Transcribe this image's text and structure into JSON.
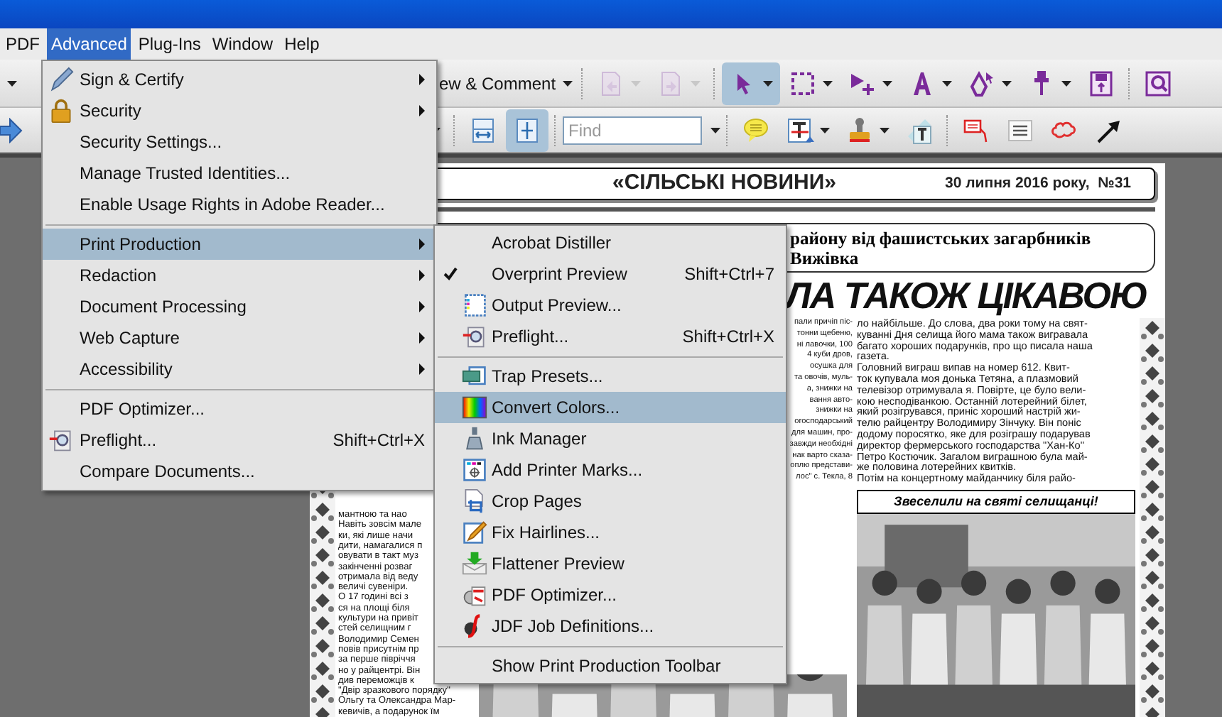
{
  "menubar": [
    {
      "label": "PDF",
      "selected": false
    },
    {
      "label": "Advanced",
      "selected": true
    },
    {
      "label": "Plug-Ins",
      "selected": false
    },
    {
      "label": "Window",
      "selected": false
    },
    {
      "label": "Help",
      "selected": false
    }
  ],
  "toolbar_1": [
    {
      "kind": "text",
      "label": "ew & Comment",
      "dropdown": true,
      "selected": false,
      "disabled": false
    },
    {
      "kind": "separator"
    },
    {
      "kind": "icon",
      "dropdown": true,
      "selected": false,
      "disabled": true
    },
    {
      "kind": "icon",
      "dropdown": true,
      "selected": false,
      "disabled": true
    },
    {
      "kind": "separator"
    },
    {
      "kind": "icon",
      "dropdown": true,
      "selected": true,
      "disabled": false
    },
    {
      "kind": "icon",
      "dropdown": true,
      "selected": false,
      "disabled": false
    },
    {
      "kind": "icon",
      "dropdown": true,
      "selected": false,
      "disabled": false
    },
    {
      "kind": "icon",
      "dropdown": true,
      "selected": false,
      "disabled": false
    },
    {
      "kind": "icon",
      "dropdown": true,
      "selected": false,
      "disabled": false
    },
    {
      "kind": "icon",
      "dropdown": true,
      "selected": false,
      "disabled": false
    },
    {
      "kind": "icon",
      "dropdown": false,
      "selected": false,
      "disabled": false
    },
    {
      "kind": "separator"
    },
    {
      "kind": "icon",
      "dropdown": false,
      "selected": false,
      "disabled": false
    }
  ],
  "toolbar_2": [
    {
      "kind": "separator"
    },
    {
      "kind": "icon",
      "dropdown": false,
      "selected": false,
      "disabled": false
    },
    {
      "kind": "icon",
      "dropdown": false,
      "selected": true,
      "disabled": false
    },
    {
      "kind": "separator"
    },
    {
      "kind": "field",
      "placeholder": "Find",
      "dropdown": true
    },
    {
      "kind": "separator"
    },
    {
      "kind": "icon",
      "dropdown": false,
      "selected": false,
      "disabled": false
    },
    {
      "kind": "icon",
      "dropdown": true,
      "selected": false,
      "disabled": false
    },
    {
      "kind": "icon",
      "dropdown": true,
      "selected": false,
      "disabled": false
    },
    {
      "kind": "icon",
      "dropdown": false,
      "selected": false,
      "disabled": false
    },
    {
      "kind": "separator"
    },
    {
      "kind": "icon",
      "dropdown": false,
      "selected": false,
      "disabled": false
    },
    {
      "kind": "icon",
      "dropdown": false,
      "selected": false,
      "disabled": false
    },
    {
      "kind": "icon",
      "dropdown": false,
      "selected": false,
      "disabled": false
    },
    {
      "kind": "icon",
      "dropdown": false,
      "selected": false,
      "disabled": false
    }
  ],
  "newspaper": {
    "title": "«СІЛЬСЬКІ НОВИНИ»",
    "date": "30 липня 2016 року,  №31",
    "subheadline": [
      "району від фашистських загарбників",
      "Вижівка"
    ],
    "headline": "ЛА ТАКОЖ ЦІКАВОЮ",
    "column_1": [
      "мантною та нао",
      "Навіть зовсім мале",
      "ки, які лише начи",
      "дити, намагалися п",
      "овувати в такт муз",
      "закінченні розваг",
      "отримала від веду",
      "величі сувеніри.",
      "О 17 годині всі з",
      "ся  на площі біля",
      "культури на привіт",
      "стей селищним г",
      "Володимир Семен",
      "повів присутнім пр",
      "за перше півріччя",
      "но у райцентрі. Він",
      "див переможців к",
      "\"Двір зразкового порядку\"",
      "Ольгу та Олександра Мар-",
      "кевичів, а подарунок їм"
    ],
    "column_2": [
      "пали причіп піс-",
      "тонни щебеню,",
      "ні лавочки, 100",
      "4 куби дров,",
      "осушка    для",
      "та овочів, муль-",
      "а, знижки на",
      "вання    авто-",
      "знижки на",
      "огосподарський",
      "для машин, про-",
      "завжди необхідні",
      "нак варто сказа-",
      "оплю представи-",
      "лос\" с. Текла, 8"
    ],
    "column_3": [
      "ло найбільше. До слова, два роки тому на свят-",
      "куванні Дня селища його мама також вигравала",
      "багато хороших подарунків, про що писала наша",
      "газета.",
      "Головний виграш випав на номер 612. Квит-",
      "ток купувала моя донька Тетяна, а плазмовий",
      "телевізор отримувала я. Повірте, це було вели-",
      "кою несподіванкою. Останній лотерейний білет,",
      "який розігрувався, приніс хороший настрій жи-",
      "телю райцентру Володимиру Зінчуку. Він поніс",
      "додому поросятко, яке для розіграшу подарував",
      "директор фермерського господарства \"Хан-Ко\"",
      "Петро Костючик. Загалом виграшною була май-",
      "же половина лотерейних квитків.",
      "Потім на концертному майданчику біля райо-"
    ],
    "photo_caption": "Звеселили на святі селищанці!"
  },
  "menu": [
    {
      "kind": "item",
      "label": "Sign & Certify",
      "submenu": true,
      "selected": false
    },
    {
      "kind": "item",
      "label": "Security",
      "submenu": true,
      "selected": false
    },
    {
      "kind": "item",
      "label": "Security Settings...",
      "submenu": false,
      "selected": false
    },
    {
      "kind": "item",
      "label": "Manage Trusted Identities...",
      "submenu": false,
      "selected": false
    },
    {
      "kind": "item",
      "label": "Enable Usage Rights in Adobe Reader...",
      "submenu": false,
      "selected": false
    },
    {
      "kind": "separator"
    },
    {
      "kind": "item",
      "label": "Print Production",
      "submenu": true,
      "selected": true
    },
    {
      "kind": "item",
      "label": "Redaction",
      "submenu": true,
      "selected": false
    },
    {
      "kind": "item",
      "label": "Document Processing",
      "submenu": true,
      "selected": false
    },
    {
      "kind": "item",
      "label": "Web Capture",
      "submenu": true,
      "selected": false
    },
    {
      "kind": "item",
      "label": "Accessibility",
      "submenu": true,
      "selected": false
    },
    {
      "kind": "separator"
    },
    {
      "kind": "item",
      "label": "PDF Optimizer...",
      "submenu": false,
      "selected": false
    },
    {
      "kind": "item",
      "label": "Preflight...",
      "shortcut": "Shift+Ctrl+X",
      "submenu": false,
      "selected": false
    },
    {
      "kind": "item",
      "label": "Compare Documents...",
      "submenu": false,
      "selected": false
    }
  ],
  "submenu": [
    {
      "kind": "item",
      "label": "Acrobat Distiller",
      "checked": false,
      "selected": false
    },
    {
      "kind": "item",
      "label": "Overprint Preview",
      "shortcut": "Shift+Ctrl+7",
      "checked": true,
      "selected": false
    },
    {
      "kind": "item",
      "label": "Output Preview...",
      "checked": false,
      "selected": false
    },
    {
      "kind": "item",
      "label": "Preflight...",
      "shortcut": "Shift+Ctrl+X",
      "checked": false,
      "selected": false
    },
    {
      "kind": "separator"
    },
    {
      "kind": "item",
      "label": "Trap Presets...",
      "checked": false,
      "selected": false
    },
    {
      "kind": "item",
      "label": "Convert Colors...",
      "checked": false,
      "selected": true
    },
    {
      "kind": "item",
      "label": "Ink Manager",
      "checked": false,
      "selected": false
    },
    {
      "kind": "item",
      "label": "Add Printer Marks...",
      "checked": false,
      "selected": false
    },
    {
      "kind": "item",
      "label": "Crop Pages",
      "checked": false,
      "selected": false
    },
    {
      "kind": "item",
      "label": "Fix Hairlines...",
      "checked": false,
      "selected": false
    },
    {
      "kind": "item",
      "label": "Flattener Preview",
      "checked": false,
      "selected": false
    },
    {
      "kind": "item",
      "label": "PDF Optimizer...",
      "checked": false,
      "selected": false
    },
    {
      "kind": "item",
      "label": "JDF Job Definitions...",
      "checked": false,
      "selected": false
    },
    {
      "kind": "separator"
    },
    {
      "kind": "item",
      "label": "Show Print Production Toolbar",
      "checked": false,
      "selected": false
    }
  ]
}
